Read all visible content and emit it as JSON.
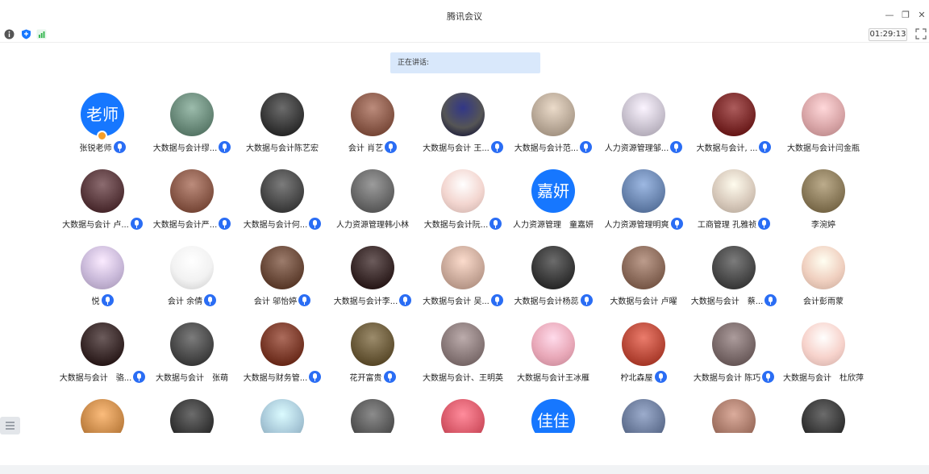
{
  "window": {
    "title": "腾讯会议",
    "minimize_icon": "minimize-icon",
    "restore_icon": "restore-icon",
    "close_icon": "close-icon"
  },
  "toolbar": {
    "info_icon": "info-icon",
    "shield_icon": "shield-icon",
    "signal_icon": "signal-icon",
    "timer": "01:29:13",
    "fullscreen_icon": "fullscreen-icon"
  },
  "speaking": {
    "label": "正在讲话:"
  },
  "colors": {
    "accent": "#1677ff",
    "speaking_bg": "#d9e8fb",
    "mic": "#2a6df4",
    "host_badge": "#f59e2a"
  },
  "participants": [
    {
      "name": "张锐老师",
      "avatar_text": "老师",
      "mic": true,
      "host": true
    },
    {
      "name": "大数据与会计缪...",
      "mic": true,
      "color": "#6a8a7a"
    },
    {
      "name": "大数据与会计陈艺宏",
      "mic": false,
      "color": "#3a3a3a"
    },
    {
      "name": "会计 肖艺",
      "mic": true,
      "color": "#8a5a4a"
    },
    {
      "name": "大数据与会计 王...",
      "mic": true,
      "color": "#555"
    },
    {
      "name": "大数据与会计范...",
      "mic": true,
      "color": "#b9a998"
    },
    {
      "name": "人力资源管理邹...",
      "mic": true,
      "color": "#c9c2cf"
    },
    {
      "name": "大数据与会计, ...",
      "mic": true,
      "color": "#7a2a2a"
    },
    {
      "name": "大数据与会计闫金瓶",
      "mic": false,
      "color": "#d9a6a8"
    },
    {
      "name": "大数据与会计 卢...",
      "mic": true,
      "color": "#5a3a3e"
    },
    {
      "name": "大数据与会计严...",
      "mic": true,
      "color": "#8a5a4a"
    },
    {
      "name": "大数据与会计何...",
      "mic": true,
      "color": "#4a4a4a"
    },
    {
      "name": "人力资源管理韩小林",
      "mic": false,
      "color": "#6a6a6a"
    },
    {
      "name": "大数据与会计阮...",
      "mic": true,
      "color": "#f3d6d0"
    },
    {
      "name": "人力资源管理　童嘉妍",
      "avatar_text": "嘉妍",
      "mic": false
    },
    {
      "name": "人力资源管理明爽",
      "mic": true,
      "color": "#6b86b0"
    },
    {
      "name": "工商管理 孔雅祯",
      "mic": true,
      "color": "#d8cabc"
    },
    {
      "name": "李涴婷",
      "mic": false,
      "color": "#8a7a5a"
    },
    {
      "name": "悦",
      "mic": true,
      "color": "#c9b9d9"
    },
    {
      "name": "会计 余倩",
      "mic": true,
      "color": "#f2f2f2"
    },
    {
      "name": "会计 邬怡婷",
      "mic": true,
      "color": "#6a4a3a"
    },
    {
      "name": "大数据与会计李...",
      "mic": true,
      "color": "#3a2a2a"
    },
    {
      "name": "大数据与会计 吴...",
      "mic": true,
      "color": "#c9a99a"
    },
    {
      "name": "大数据与会计杨蕊",
      "mic": true,
      "color": "#3a3a3a"
    },
    {
      "name": "大数据与会计 卢曜",
      "mic": false,
      "color": "#8a6a5a"
    },
    {
      "name": "大数据与会计　蔡...",
      "mic": true,
      "color": "#4a4a4a"
    },
    {
      "name": "会计彭雨蒙",
      "mic": false,
      "color": "#f0d0c0"
    },
    {
      "name": "大数据与会计　骆...",
      "mic": true,
      "color": "#3a2a2a"
    },
    {
      "name": "大数据与会计　张萌",
      "mic": false,
      "color": "#4a4a4a"
    },
    {
      "name": "大数据与财务管...",
      "mic": true,
      "color": "#7a3a2a"
    },
    {
      "name": "花开富贵",
      "mic": true,
      "color": "#6a5a3a"
    },
    {
      "name": "大数据与会计、王明英",
      "mic": false,
      "color": "#8a7a7a"
    },
    {
      "name": "大数据与会计王冰雁",
      "mic": false,
      "color": "#e9a9b9"
    },
    {
      "name": "柠北森屋",
      "mic": true,
      "color": "#b94a3a"
    },
    {
      "name": "大数据与会计 陈巧",
      "mic": true,
      "color": "#7a6a6a"
    },
    {
      "name": "大数据与会计　杜欣萍",
      "mic": false,
      "color": "#f7d3cc"
    },
    {
      "name": "",
      "mic": false,
      "color": "#c98a4a"
    },
    {
      "name": "",
      "mic": false,
      "color": "#3a3a3a"
    },
    {
      "name": "",
      "mic": false,
      "color": "#a9c9d9"
    },
    {
      "name": "",
      "mic": false,
      "color": "#5a5a5a"
    },
    {
      "name": "",
      "mic": false,
      "color": "#d95a6a"
    },
    {
      "name": "",
      "avatar_text": "佳佳",
      "mic": false
    },
    {
      "name": "",
      "mic": false,
      "color": "#6a7a9a"
    },
    {
      "name": "",
      "mic": false,
      "color": "#a97a6a"
    },
    {
      "name": "",
      "mic": false,
      "color": "#3a3a3a"
    }
  ],
  "sidebar_toggle_icon": "list-icon"
}
